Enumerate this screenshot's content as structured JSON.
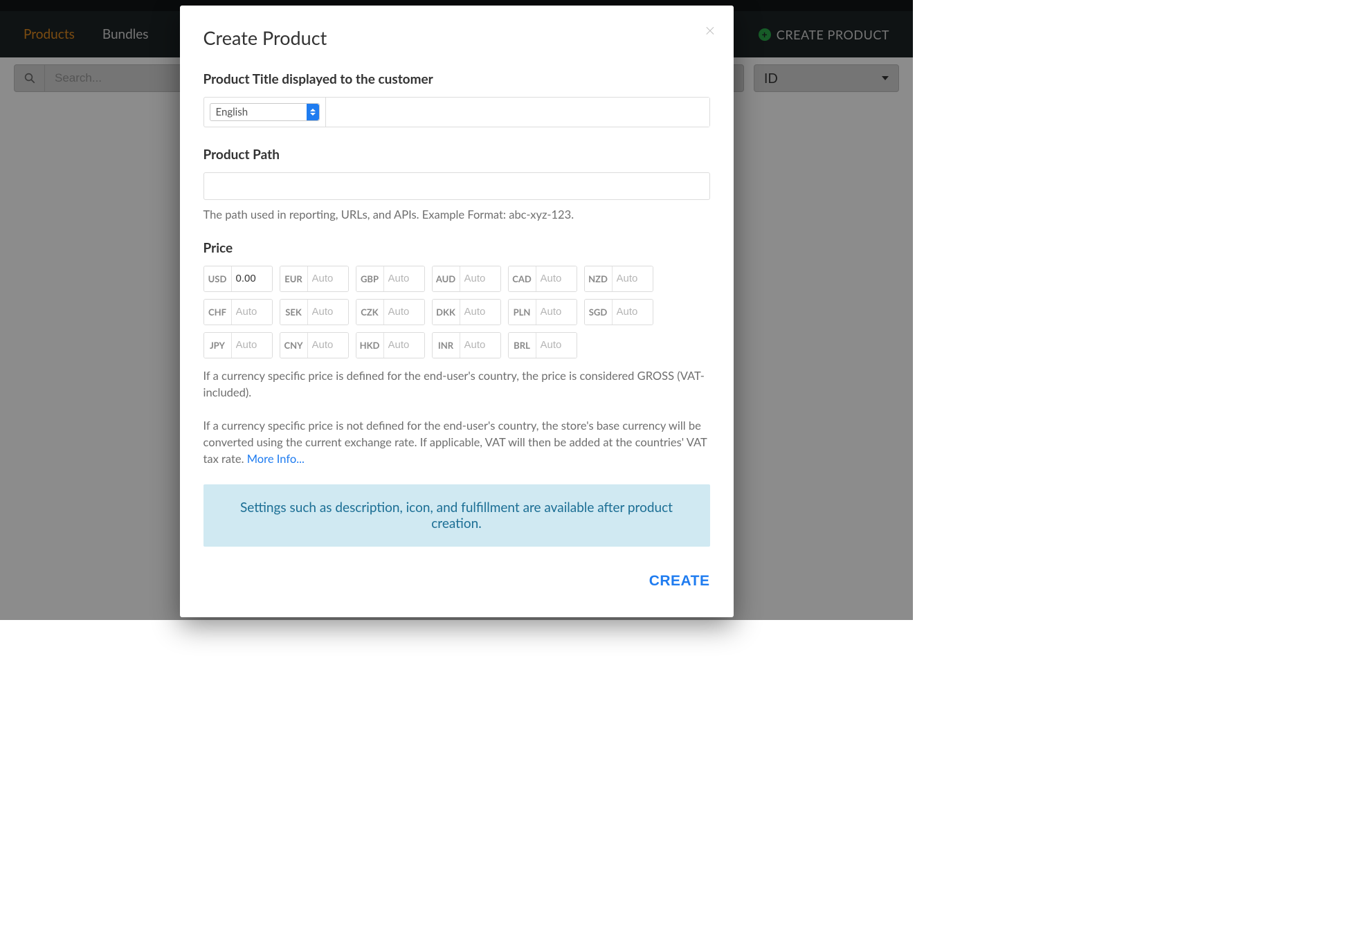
{
  "tabs": {
    "products": "Products",
    "bundles": "Bundles"
  },
  "header": {
    "create_product_btn": "CREATE PRODUCT"
  },
  "filter": {
    "search_placeholder": "Search...",
    "id_dropdown": "ID"
  },
  "modal": {
    "title": "Create Product",
    "section_title_label": "Product Title displayed to the customer",
    "language_selected": "English",
    "title_value": "",
    "section_path_label": "Product Path",
    "path_value": "",
    "path_help": "The path used in reporting, URLs, and APIs. Example Format: abc-xyz-123.",
    "section_price_label": "Price",
    "currencies": [
      {
        "code": "USD",
        "value": "0.00",
        "placeholder": ""
      },
      {
        "code": "EUR",
        "value": "",
        "placeholder": "Auto"
      },
      {
        "code": "GBP",
        "value": "",
        "placeholder": "Auto"
      },
      {
        "code": "AUD",
        "value": "",
        "placeholder": "Auto"
      },
      {
        "code": "CAD",
        "value": "",
        "placeholder": "Auto"
      },
      {
        "code": "NZD",
        "value": "",
        "placeholder": "Auto"
      },
      {
        "code": "CHF",
        "value": "",
        "placeholder": "Auto"
      },
      {
        "code": "SEK",
        "value": "",
        "placeholder": "Auto"
      },
      {
        "code": "CZK",
        "value": "",
        "placeholder": "Auto"
      },
      {
        "code": "DKK",
        "value": "",
        "placeholder": "Auto"
      },
      {
        "code": "PLN",
        "value": "",
        "placeholder": "Auto"
      },
      {
        "code": "SGD",
        "value": "",
        "placeholder": "Auto"
      },
      {
        "code": "JPY",
        "value": "",
        "placeholder": "Auto"
      },
      {
        "code": "CNY",
        "value": "",
        "placeholder": "Auto"
      },
      {
        "code": "HKD",
        "value": "",
        "placeholder": "Auto"
      },
      {
        "code": "INR",
        "value": "",
        "placeholder": "Auto"
      },
      {
        "code": "BRL",
        "value": "",
        "placeholder": "Auto"
      }
    ],
    "price_help_1": "If a currency specific price is defined for the end-user's country, the price is considered GROSS (VAT-included).",
    "price_help_2_a": "If a currency specific price is not defined for the end-user's country, the store's base currency will be converted using the current exchange rate. If applicable, VAT will then be added at the countries' VAT tax rate. ",
    "price_help_2_link": "More Info...",
    "banner": "Settings such as description, icon, and fulfillment are available after product creation.",
    "create_btn": "CREATE"
  }
}
